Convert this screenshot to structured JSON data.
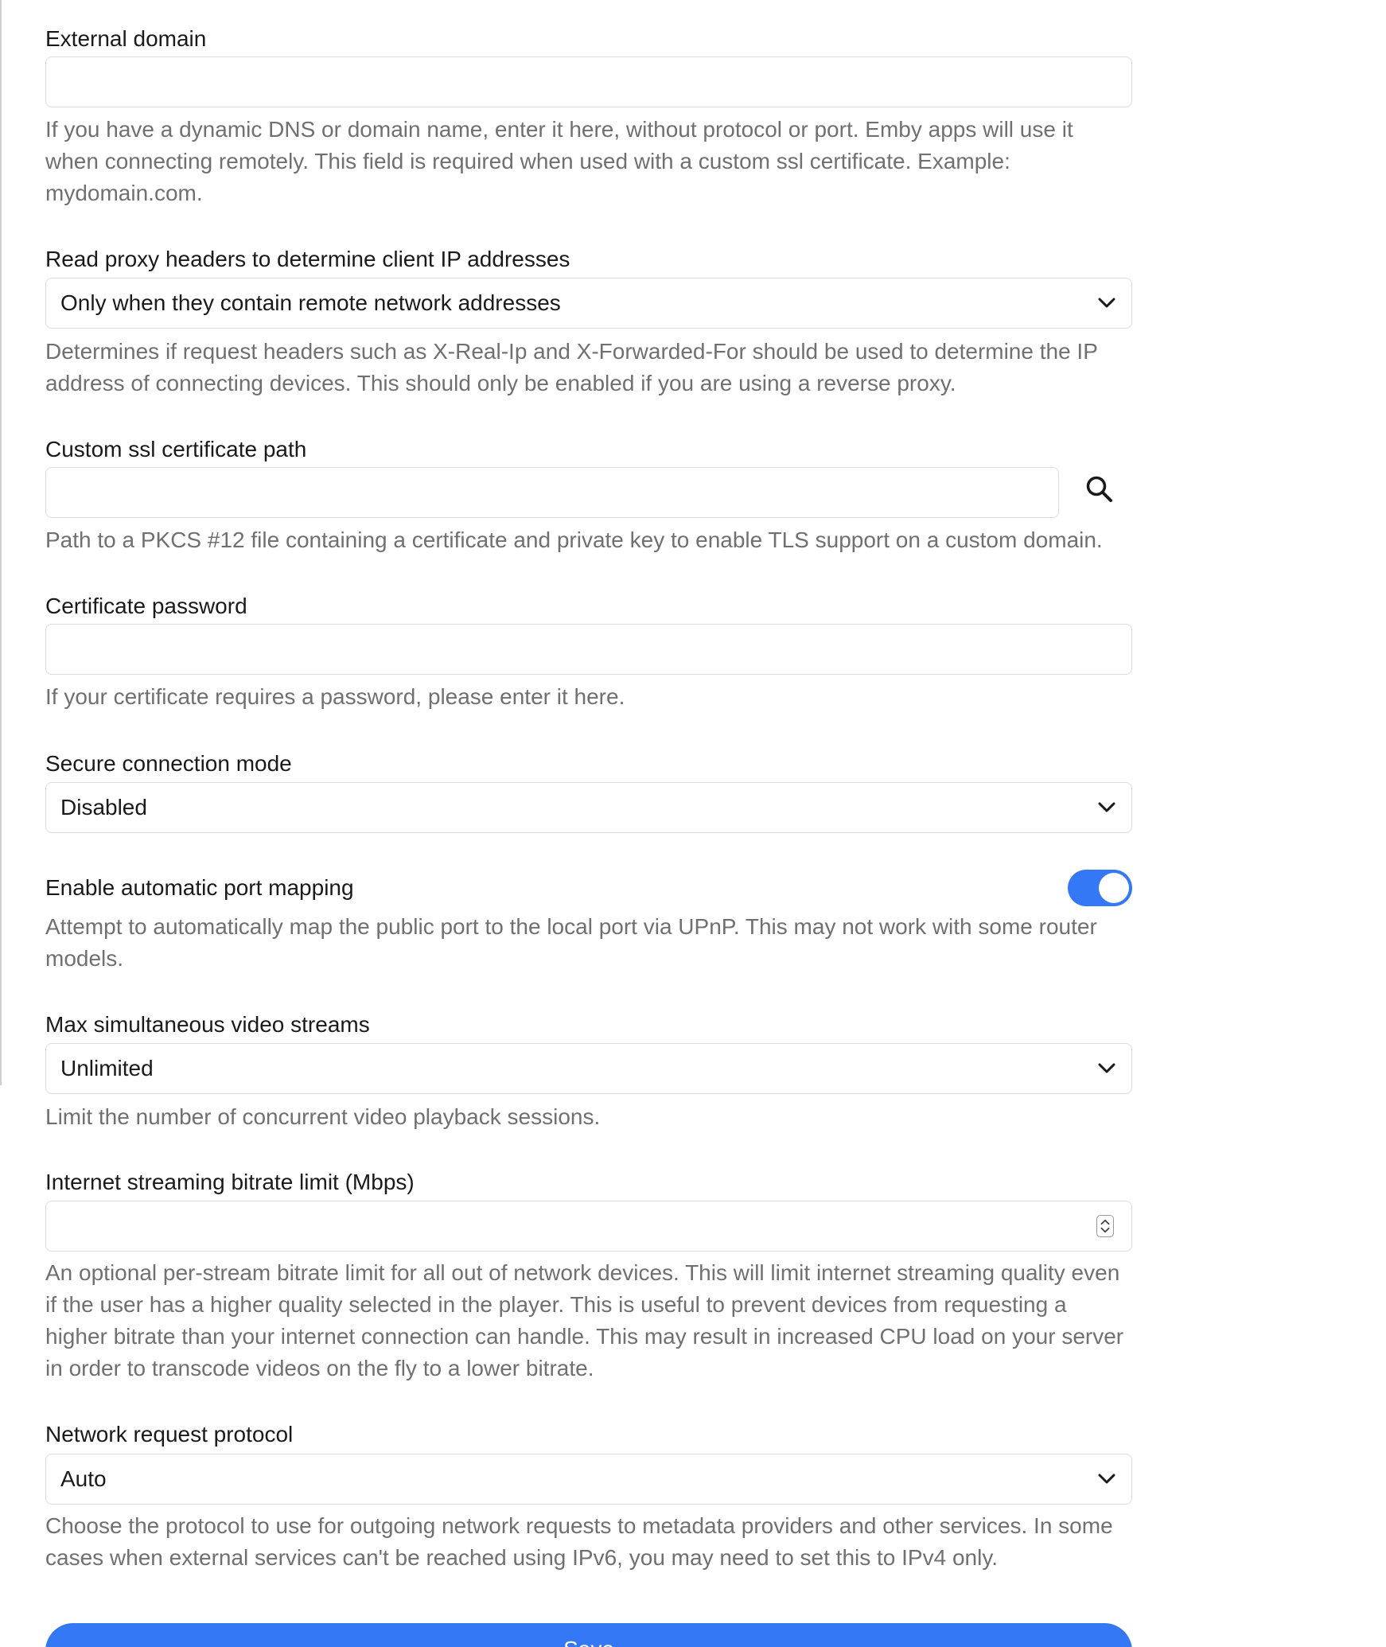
{
  "colors": {
    "accent": "#3478f6",
    "help_text": "#707070",
    "border": "#dcdcdc"
  },
  "external_domain": {
    "label": "External domain",
    "value": "",
    "help": "If you have a dynamic DNS or domain name, enter it here, without protocol or port. Emby apps will use it when connecting remotely. This field is required when used with a custom ssl certificate. Example: mydomain.com."
  },
  "proxy_headers": {
    "label": "Read proxy headers to determine client IP addresses",
    "selected": "Only when they contain remote network addresses",
    "help": "Determines if request headers such as X-Real-Ip and X-Forwarded-For should be used to determine the IP address of connecting devices. This should only be enabled if you are using a reverse proxy."
  },
  "ssl_certificate": {
    "label": "Custom ssl certificate path",
    "value": "",
    "browse_icon": "search-icon",
    "help": "Path to a PKCS #12 file containing a certificate and private key to enable TLS support on a custom domain."
  },
  "certificate_password": {
    "label": "Certificate password",
    "value": "",
    "help": "If your certificate requires a password, please enter it here."
  },
  "secure_connection": {
    "label": "Secure connection mode",
    "selected": "Disabled"
  },
  "port_mapping": {
    "label": "Enable automatic port mapping",
    "enabled": true,
    "help": "Attempt to automatically map the public port to the local port via UPnP. This may not work with some router models."
  },
  "max_streams": {
    "label": "Max simultaneous video streams",
    "selected": "Unlimited",
    "help": "Limit the number of concurrent video playback sessions."
  },
  "bitrate_limit": {
    "label": "Internet streaming bitrate limit (Mbps)",
    "value": "",
    "help": "An optional per-stream bitrate limit for all out of network devices. This will limit internet streaming quality even if the user has a higher quality selected in the player. This is useful to prevent devices from requesting a higher bitrate than your internet connection can handle. This may result in increased CPU load on your server in order to transcode videos on the fly to a lower bitrate."
  },
  "request_protocol": {
    "label": "Network request protocol",
    "selected": "Auto",
    "help": "Choose the protocol to use for outgoing network requests to metadata providers and other services. In some cases when external services can't be reached using IPv6, you may need to set this to IPv4 only."
  },
  "save_button": {
    "label": "Save"
  }
}
